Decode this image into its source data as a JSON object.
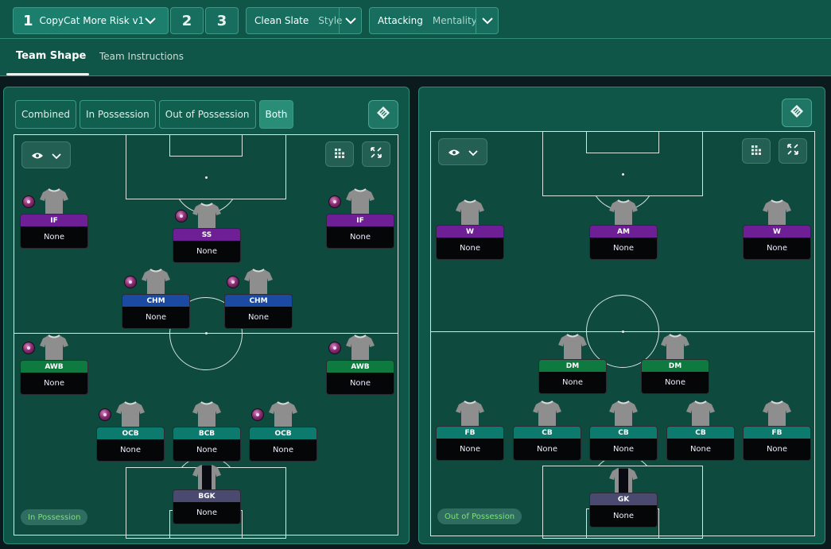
{
  "header": {
    "tactic_slot_1": {
      "number": "1",
      "name": "CopyCat More Risk v1"
    },
    "tactic_slot_2": "2",
    "tactic_slot_3": "3",
    "style": {
      "value": "Clean Slate",
      "label": "Style"
    },
    "mentality": {
      "value": "Attacking",
      "label": "Mentality"
    }
  },
  "tabs": {
    "team_shape": "Team Shape",
    "team_instructions": "Team Instructions"
  },
  "left_panel": {
    "segments": {
      "combined": "Combined",
      "in_possession": "In Possession",
      "out_of_possession": "Out of Possession",
      "both": "Both"
    },
    "active_segment": "Both",
    "phase_badge": "In Possession",
    "players": [
      {
        "role": "IF",
        "duty": "None",
        "color": "#6e1f95",
        "trait": true
      },
      {
        "role": "SS",
        "duty": "None",
        "color": "#6e1f95",
        "trait": true
      },
      {
        "role": "IF",
        "duty": "None",
        "color": "#6e1f95",
        "trait": true
      },
      {
        "role": "CHM",
        "duty": "None",
        "color": "#1b4aa3",
        "trait": true
      },
      {
        "role": "CHM",
        "duty": "None",
        "color": "#1b4aa3",
        "trait": true
      },
      {
        "role": "AWB",
        "duty": "None",
        "color": "#0f7a3f",
        "trait": true
      },
      {
        "role": "AWB",
        "duty": "None",
        "color": "#0f7a3f",
        "trait": true
      },
      {
        "role": "OCB",
        "duty": "None",
        "color": "#0d7a6e",
        "trait": true
      },
      {
        "role": "BCB",
        "duty": "None",
        "color": "#0d7a6e",
        "trait": false
      },
      {
        "role": "OCB",
        "duty": "None",
        "color": "#0d7a6e",
        "trait": true
      },
      {
        "role": "BGK",
        "duty": "None",
        "color": "#4a4a70",
        "trait": false
      }
    ]
  },
  "right_panel": {
    "phase_badge": "Out of Possession",
    "players": [
      {
        "role": "W",
        "duty": "None",
        "color": "#6e1f95"
      },
      {
        "role": "AM",
        "duty": "None",
        "color": "#6e1f95"
      },
      {
        "role": "W",
        "duty": "None",
        "color": "#6e1f95"
      },
      {
        "role": "DM",
        "duty": "None",
        "color": "#0f7a3f"
      },
      {
        "role": "DM",
        "duty": "None",
        "color": "#0f7a3f"
      },
      {
        "role": "FB",
        "duty": "None",
        "color": "#0d7a6e"
      },
      {
        "role": "CB",
        "duty": "None",
        "color": "#0d7a6e"
      },
      {
        "role": "CB",
        "duty": "None",
        "color": "#0d7a6e"
      },
      {
        "role": "CB",
        "duty": "None",
        "color": "#0d7a6e"
      },
      {
        "role": "FB",
        "duty": "None",
        "color": "#0d7a6e"
      },
      {
        "role": "GK",
        "duty": "None",
        "color": "#4a4a70"
      }
    ]
  },
  "icons": {
    "chevron": "chevron-down-icon",
    "eye": "eye-icon",
    "formation": "formation-grid-icon",
    "expand": "expand-icon",
    "swap": "swap-diamond-icon"
  }
}
